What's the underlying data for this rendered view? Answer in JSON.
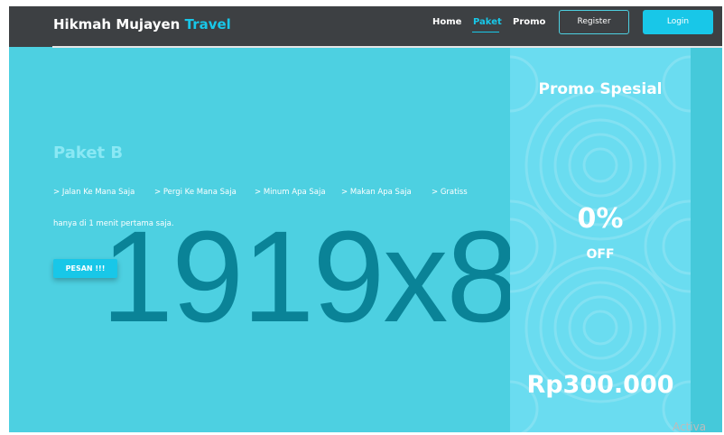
{
  "brand": {
    "name": "Hikmah Mujayen",
    "accent": "Travel"
  },
  "nav": {
    "home": "Home",
    "paket": "Paket",
    "promo": "Promo",
    "register": "Register",
    "login": "Login"
  },
  "hero": {
    "placeholder": "1919x8",
    "title": "Paket B",
    "features": [
      "> Jalan Ke Mana Saja",
      "> Pergi Ke Mana Saja",
      "> Minum Apa Saja",
      "> Makan Apa Saja",
      "> Gratiss"
    ],
    "description": "hanya di 1 menit pertama saja.",
    "order_button": "PESAN !!!"
  },
  "promo": {
    "title": "Promo Spesial",
    "discount": "0%",
    "off_label": "OFF",
    "price": "Rp300.000"
  },
  "watermark": "Activa",
  "colors": {
    "accent": "#18c7e8",
    "hero_bg": "#4dd0e1",
    "navbar_bg": "#3d4043",
    "promo_bg": "#6adcf0"
  }
}
